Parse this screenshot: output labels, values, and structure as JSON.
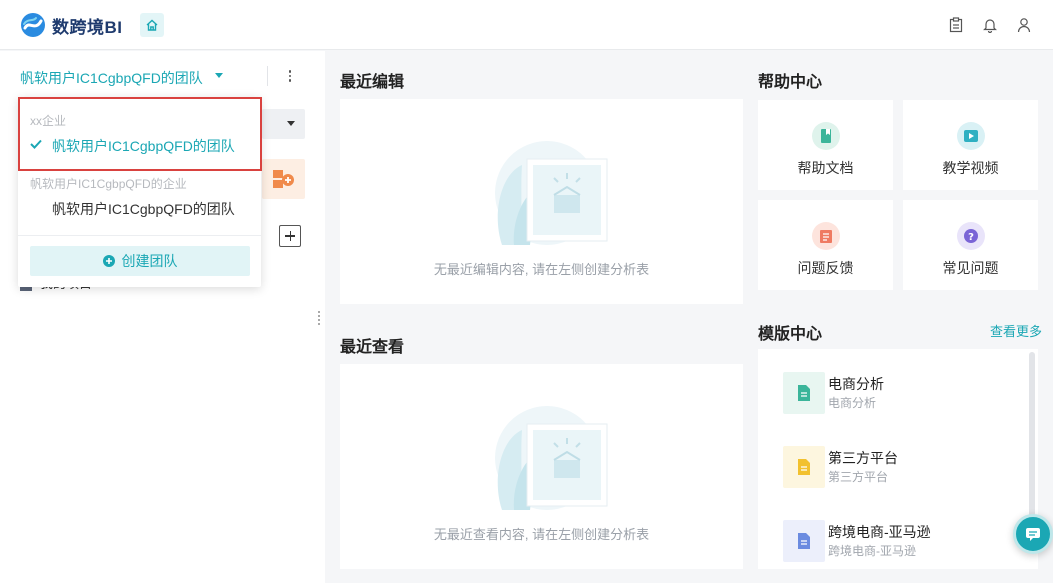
{
  "app": {
    "name": "数跨境BI"
  },
  "sidebar": {
    "team_name": "帆软用户IC1CgbpQFD的团队",
    "behind_item_text": "我的项目"
  },
  "dropdown": {
    "group1": "xx企业",
    "selected": "帆软用户IC1CgbpQFD的团队",
    "group2": "帆软用户IC1CgbpQFD的企业",
    "item": "帆软用户IC1CgbpQFD的团队",
    "create_label": "创建团队"
  },
  "recent_edit": {
    "title": "最近编辑",
    "empty_text": "无最近编辑内容, 请在左侧创建分析表"
  },
  "recent_view": {
    "title": "最近查看",
    "empty_text": "无最近查看内容, 请在左侧创建分析表"
  },
  "help": {
    "title": "帮助中心",
    "cards": [
      {
        "label": "帮助文档",
        "icon": "document-icon",
        "color": "#3bb59a"
      },
      {
        "label": "教学视频",
        "icon": "video-icon",
        "color": "#2fb0c2"
      },
      {
        "label": "问题反馈",
        "icon": "feedback-icon",
        "color": "#ef7b62"
      },
      {
        "label": "常见问题",
        "icon": "question-icon",
        "color": "#7a64d6"
      }
    ]
  },
  "templates": {
    "title": "模版中心",
    "more": "查看更多",
    "items": [
      {
        "title": "电商分析",
        "subtitle": "电商分析",
        "color": "#3bb59a"
      },
      {
        "title": "第三方平台",
        "subtitle": "第三方平台",
        "color": "#f2c12e"
      },
      {
        "title": "跨境电商-亚马逊",
        "subtitle": "跨境电商-亚马逊",
        "color": "#6b8be0"
      }
    ]
  },
  "colors": {
    "accent": "#1ba7b4",
    "highlight_border": "#d9423f"
  }
}
